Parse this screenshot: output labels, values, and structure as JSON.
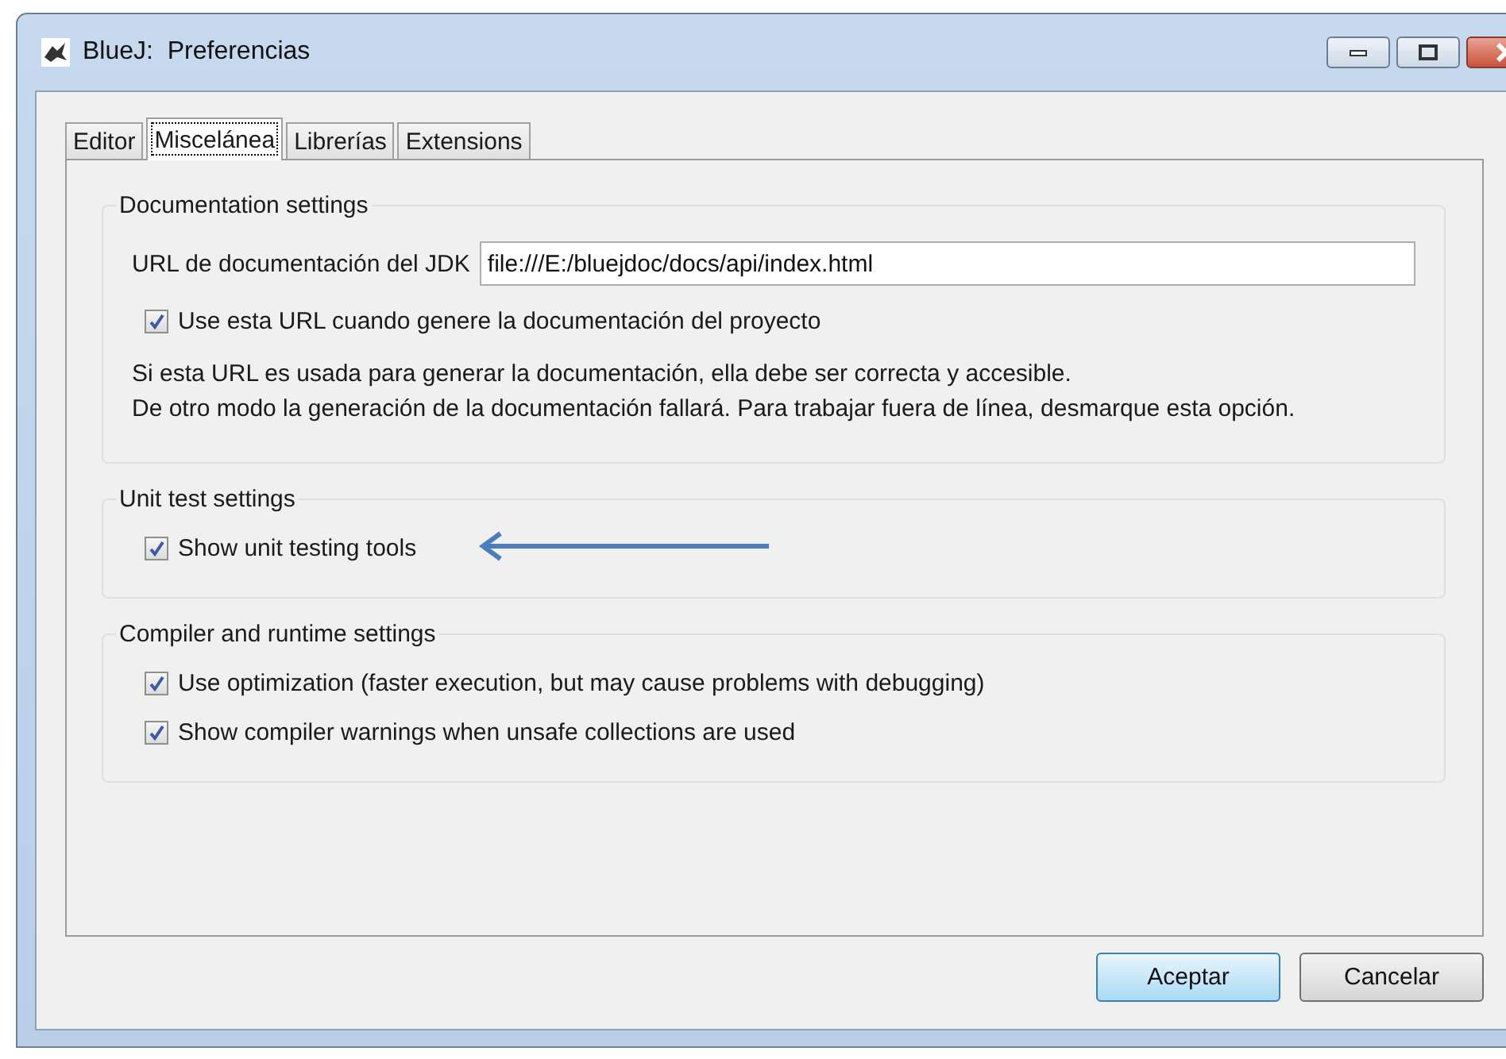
{
  "window": {
    "title": "BlueJ:  Preferencias"
  },
  "tabs": [
    {
      "label": "Editor",
      "selected": false
    },
    {
      "label": "Miscelánea",
      "selected": true
    },
    {
      "label": "Librerías",
      "selected": false
    },
    {
      "label": "Extensions",
      "selected": false
    }
  ],
  "groups": [
    {
      "title": "Documentation settings",
      "items": [
        {
          "kind": "field",
          "label": "URL de documentación del JDK",
          "value": "file:///E:/bluejdoc/docs/api/index.html"
        },
        {
          "kind": "checkbox",
          "label": "Use esta URL cuando genere la documentación del proyecto",
          "checked": true
        },
        {
          "kind": "note",
          "lines": [
            "Si esta URL es usada para generar la documentación, ella debe ser correcta y accesible.",
            "De otro modo la generación de la documentación fallará. Para trabajar fuera de línea, desmarque esta opción."
          ]
        }
      ]
    },
    {
      "title": "Unit test settings",
      "items": [
        {
          "kind": "checkbox",
          "label": "Show unit testing tools",
          "checked": true,
          "pointer": true
        }
      ]
    },
    {
      "title": "Compiler and runtime settings",
      "items": [
        {
          "kind": "checkbox",
          "label": "Use optimization (faster execution, but may cause problems with debugging)",
          "checked": true
        },
        {
          "kind": "checkbox",
          "label": "Show compiler warnings when unsafe collections are used",
          "checked": true
        }
      ]
    }
  ],
  "buttons": [
    {
      "label": "Aceptar",
      "default": true
    },
    {
      "label": "Cancelar",
      "default": false
    }
  ]
}
